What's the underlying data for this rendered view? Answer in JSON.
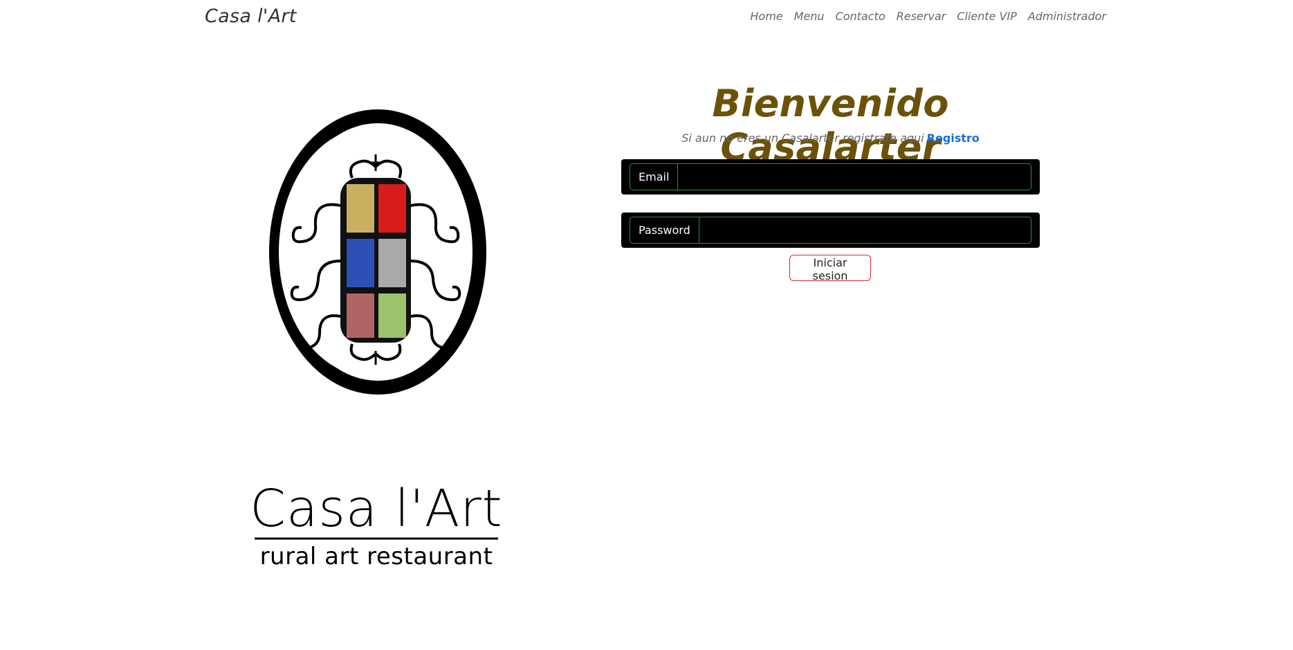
{
  "navbar": {
    "brand": "Casa l'Art",
    "links": [
      "Home",
      "Menu",
      "Contacto",
      "Reservar",
      "Cliente VIP",
      "Administrador"
    ]
  },
  "logo": {
    "wordmark": "Casa l'Art",
    "tagline": "rural art restaurant",
    "pane_colors": [
      "#c9b060",
      "#d81c1c",
      "#2e4fb8",
      "#a9a9a9",
      "#b06464",
      "#9cc26c"
    ]
  },
  "login": {
    "title": "Bienvenido Casalarter",
    "register_prompt": "Si aun no eres un Casalarter registrate aqui",
    "register_link": "Registro",
    "email_label": "Email",
    "email_value": "",
    "password_label": "Password",
    "password_value": "",
    "submit_label": "Iniciar sesion"
  },
  "colors": {
    "title": "#6b5208",
    "link": "#1a6fdb",
    "field_border": "#2f8f47",
    "button_border": "#d9262f"
  }
}
